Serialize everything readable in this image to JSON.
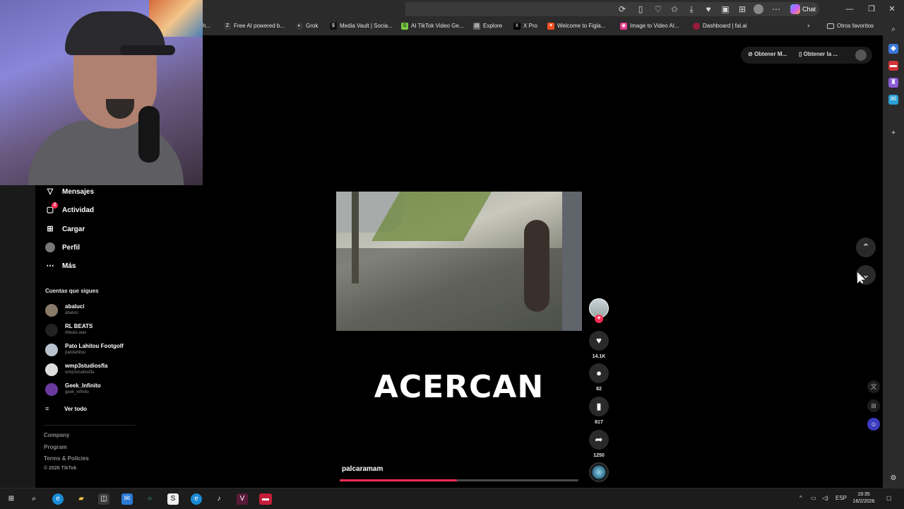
{
  "browser": {
    "chat_label": "Chat",
    "bookmarks": [
      {
        "label": "h...",
        "icon": "bookmark-icon",
        "color": "#2b2b2b"
      },
      {
        "label": "Free AI powered b...",
        "icon": "z-icon",
        "color": "#3a3a3a"
      },
      {
        "label": "Grok",
        "icon": "grok-icon",
        "color": "#3a3a3a"
      },
      {
        "label": "Media Vault | Socia...",
        "icon": "s-icon",
        "color": "#111111"
      },
      {
        "label": "AI TikTok Video Ge...",
        "icon": "s-icon",
        "color": "#7ac943"
      },
      {
        "label": "Explore",
        "icon": "page-icon",
        "color": "#555555"
      },
      {
        "label": "X Pro",
        "icon": "x-icon",
        "color": "#000000"
      },
      {
        "label": "Welcome to Figla...",
        "icon": "figma-icon",
        "color": "#f24e1e"
      },
      {
        "label": "Image to Video AI...",
        "icon": "image-icon",
        "color": "#e23b8a"
      },
      {
        "label": "Dashboard | fal.ai",
        "icon": "fal-icon",
        "color": "#9b1b3c"
      }
    ],
    "other_favorites": "Otros favoritos"
  },
  "sidebar": {
    "items": [
      {
        "label": "Mensajes",
        "icon": "send-icon"
      },
      {
        "label": "Actividad",
        "icon": "activity-icon",
        "badge": "2"
      },
      {
        "label": "Cargar",
        "icon": "upload-icon"
      },
      {
        "label": "Perfil",
        "icon": "profile-icon"
      },
      {
        "label": "Más",
        "icon": "more-icon"
      }
    ],
    "following_title": "Cuentas que sigues",
    "accounts": [
      {
        "name": "abaluci",
        "handle": "abaluci",
        "color": "#8a7a6a"
      },
      {
        "name": "RL BEATS",
        "handle": "rlbeats.wav",
        "color": "#222222"
      },
      {
        "name": "Pato Lahitou Footgolf",
        "handle": "patolahitou",
        "color": "#b9c3cf"
      },
      {
        "name": "wmp3studiosfla",
        "handle": "wmp3studiosfla",
        "color": "#dddddd"
      },
      {
        "name": "Geek_Infinito",
        "handle": "geek_infinito",
        "color": "#6a3aa0"
      }
    ],
    "see_all": "Ver todo",
    "footer": {
      "company": "Company",
      "program": "Program",
      "terms": "Terms & Policies",
      "copyright": "© 2026 TikTok"
    }
  },
  "top_actions": {
    "get_app_1": "Obtener M...",
    "get_app_2": "Obtener la ..."
  },
  "video": {
    "caption": "ACERCAN",
    "author": "palcaramam",
    "progress": 0.49,
    "likes": "14.1K",
    "comments": "82",
    "saves": "817",
    "shares": "1250"
  },
  "taskbar": {
    "language": "ESP",
    "time": "19:35",
    "date": "16/2/2026"
  }
}
